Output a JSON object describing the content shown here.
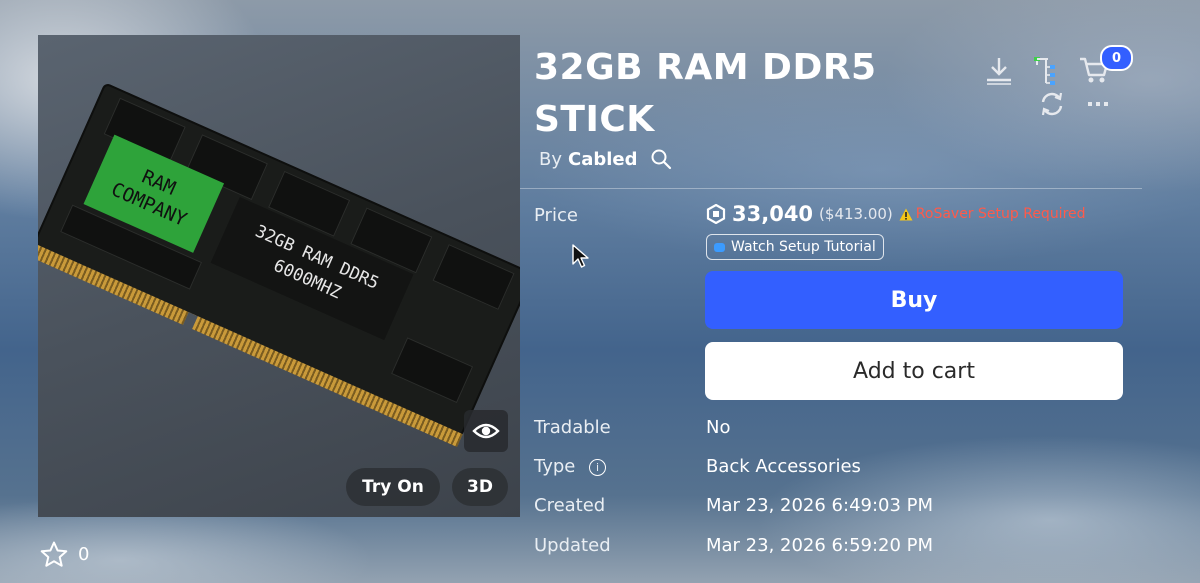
{
  "item": {
    "title": "32GB RAM DDR5 STICK",
    "by_label": "By",
    "creator": "Cabled",
    "favorites": "0"
  },
  "thumbnail": {
    "label_green": "RAM COMPANY",
    "label_dark_line1": "32GB RAM DDR5",
    "label_dark_line2": "6000MHZ",
    "try_on_label": "Try On",
    "three_d_label": "3D"
  },
  "header_icons": {
    "cart_count": "0",
    "download_icon": "download-icon",
    "structure_icon": "hierarchy-icon",
    "cart_icon": "cart-icon",
    "refresh_icon": "refresh-icon",
    "more_icon": "more-icon"
  },
  "price": {
    "label": "Price",
    "amount": "33,040",
    "usd": "($413.00)",
    "warning": "RoSaver Setup Required",
    "tutorial_label": "Watch Setup Tutorial"
  },
  "actions": {
    "buy_label": "Buy",
    "add_to_cart_label": "Add to cart"
  },
  "details": {
    "tradable_label": "Tradable",
    "tradable_value": "No",
    "type_label": "Type",
    "type_value": "Back Accessories",
    "created_label": "Created",
    "created_value": "Mar 23, 2026 6:49:03 PM",
    "updated_label": "Updated",
    "updated_value": "Mar 23, 2026 6:59:20 PM"
  },
  "colors": {
    "primary_button": "#335fff",
    "warning_text": "#ff5a4a",
    "tutorial_dot": "#3b9bff"
  }
}
